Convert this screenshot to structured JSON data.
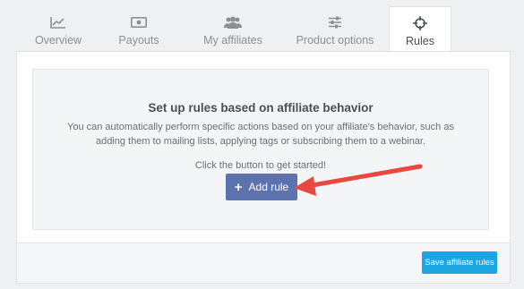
{
  "tabs": [
    {
      "label": "Overview",
      "icon": "line-chart-icon"
    },
    {
      "label": "Payouts",
      "icon": "money-icon"
    },
    {
      "label": "My affiliates",
      "icon": "users-icon"
    },
    {
      "label": "Product options",
      "icon": "sliders-icon"
    },
    {
      "label": "Rules",
      "icon": "crosshairs-icon"
    }
  ],
  "active_tab": "Rules",
  "empty_state": {
    "title": "Set up rules based on affiliate behavior",
    "description": "You can automatically perform specific actions based on your affiliate's behavior, such as adding them to mailing lists, applying tags or subscribing them to a webinar.",
    "hint": "Click the button to get started!",
    "add_button_label": "Add rule",
    "add_button_icon": "+"
  },
  "footer": {
    "save_button_label": "Save affiliate rules"
  },
  "annotation": {
    "arrow_color": "#e8493f"
  },
  "colors": {
    "add_button": "#5d73b0",
    "save_button": "#1ea5df"
  }
}
